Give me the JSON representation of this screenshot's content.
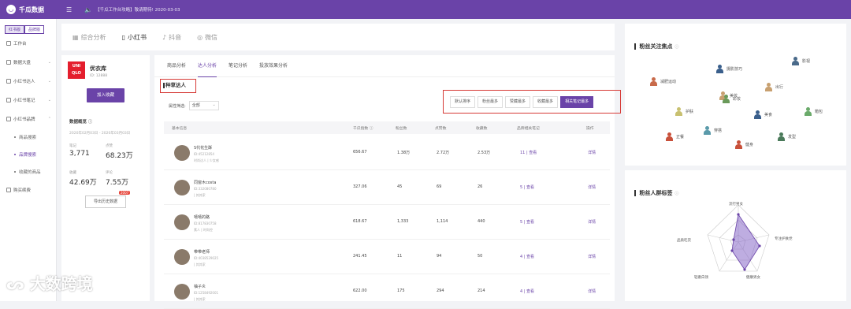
{
  "app": {
    "name": "千瓜数据",
    "notice": "【千瓜工作台攻略】敬请期待!  2020-03-03"
  },
  "sidebar": {
    "switch": [
      "红书版",
      "品牌版"
    ],
    "items": [
      {
        "label": "工作台"
      },
      {
        "label": "数据大盘"
      },
      {
        "label": "小红书达人"
      },
      {
        "label": "小红书笔记"
      },
      {
        "label": "小红书品牌"
      }
    ],
    "subitems": [
      "商品搜索",
      "品牌搜索",
      "收藏的商品"
    ],
    "last": "购买续费"
  },
  "tabs": [
    "综合分析",
    "小红书",
    "抖音",
    "微信"
  ],
  "brand": {
    "logo_text": "UNI QLO",
    "name": "优衣库",
    "id": "ID: 12888",
    "add_btn": "加入收藏",
    "overview": "数据概览",
    "range": "2020年02月03日 - 2020年03月03日",
    "stats": [
      {
        "k": "笔记",
        "v": "3,771"
      },
      {
        "k": "点赞",
        "v": "68.23万"
      },
      {
        "k": "收藏",
        "v": "42.69万"
      },
      {
        "k": "评论",
        "v": "7.55万"
      }
    ],
    "export": "导出历史数据",
    "badge": "2007"
  },
  "subtabs": [
    "商品分析",
    "达人分析",
    "笔记分析",
    "投放效果分析"
  ],
  "section": "种草达人",
  "filter": {
    "label": "属性筛选:",
    "value": "全部"
  },
  "sorts": [
    "默认排序",
    "粉丝最多",
    "赞藏最多",
    "收藏最多",
    "相关笔记最多"
  ],
  "table": {
    "headers": [
      "基本信息",
      "千瓜指数 ⓘ",
      "粉丝数",
      "点赞数",
      "收藏数",
      "品牌相关笔记",
      "操作"
    ],
    "rows": [
      {
        "name": "S代花生酥",
        "info": "ID:45212854",
        "tag": "时尚达人 | 少女感",
        "idx": "656.67",
        "fans": "1.38万",
        "likes": "2.72万",
        "fav": "2.53万",
        "notes": "11 | 查看",
        "op": "详情"
      },
      {
        "name": "同窗木costa",
        "info": "ID:332080780",
        "tag": "| 其其家",
        "idx": "327.06",
        "fans": "45",
        "likes": "69",
        "fav": "26",
        "notes": "5 | 查看",
        "op": "详情"
      },
      {
        "name": "嘻嘻的路",
        "info": "ID:817830758",
        "tag": "素人 | 时尚控",
        "idx": "618.67",
        "fans": "1,333",
        "likes": "1,114",
        "fav": "440",
        "notes": "5 | 查看",
        "op": "详情"
      },
      {
        "name": "带带老师",
        "info": "ID:4038529025",
        "tag": "| 其其家",
        "idx": "241.45",
        "fans": "11",
        "likes": "94",
        "fav": "50",
        "notes": "4 | 查看",
        "op": "详情"
      },
      {
        "name": "柚子炎",
        "info": "ID:1258492001",
        "tag": "| 其其家",
        "idx": "622.00",
        "fans": "175",
        "likes": "294",
        "fav": "214",
        "notes": "4 | 查看",
        "op": "详情"
      }
    ]
  },
  "focus": {
    "title": "粉丝关注焦点",
    "items": [
      {
        "label": "影视",
        "color": "#4a6a8a"
      },
      {
        "label": "摄影技巧",
        "color": "#3a5f8c"
      },
      {
        "label": "减肥运动",
        "color": "#c86a4a"
      },
      {
        "label": "美妆",
        "color": "#c8a070"
      },
      {
        "label": "出行",
        "color": "#c8a070"
      },
      {
        "label": "彩妆",
        "color": "#6a9a5a"
      },
      {
        "label": "护肤",
        "color": "#c8c070"
      },
      {
        "label": "美食",
        "color": "#3a5f8c"
      },
      {
        "label": "箱包",
        "color": "#6aaa6a"
      },
      {
        "label": "穿搭",
        "color": "#5a9aaa"
      },
      {
        "label": "正餐",
        "color": "#c8503a"
      },
      {
        "label": "发型",
        "color": "#4a7a5a"
      },
      {
        "label": "健身",
        "color": "#c8503a"
      }
    ]
  },
  "crowd": {
    "title": "粉丝人群标签",
    "labels": [
      "流行男女",
      "专注护肤党",
      "健康男女",
      "轻奢白领",
      "品质吃货"
    ]
  },
  "watermark": "大数跨境",
  "colors": {
    "brand": "#6a43a8",
    "highlight": "#d63a36"
  }
}
